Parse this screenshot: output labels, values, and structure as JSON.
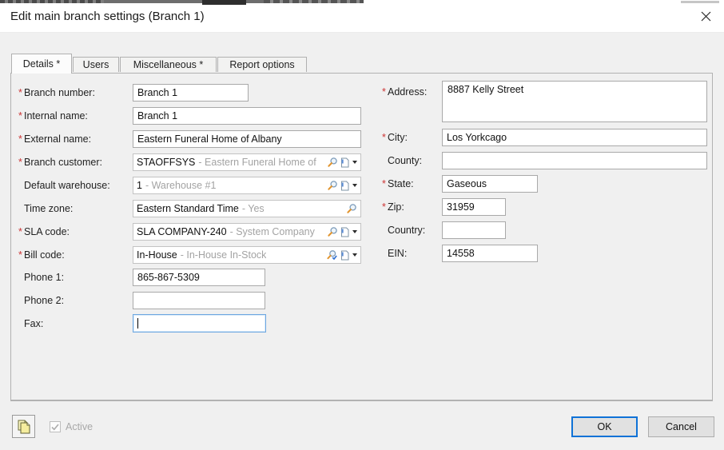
{
  "window": {
    "title": "Edit main branch settings (Branch 1)"
  },
  "icons": {
    "close": "✕",
    "lookup": "magnifier",
    "lookup_verified": "magnifier-with-check",
    "quick_add": "page-with-caret",
    "copy": "stacked-pages",
    "active_check": "✓"
  },
  "marks": {
    "required": "*"
  },
  "tabs": [
    {
      "label": "Details *",
      "active": true
    },
    {
      "label": "Users",
      "active": false
    },
    {
      "label": "Miscellaneous *",
      "active": false
    },
    {
      "label": "Report options",
      "active": false
    }
  ],
  "form": {
    "left": [
      {
        "label": "Branch number:",
        "required": true,
        "value": "Branch 1"
      },
      {
        "label": "Internal name:",
        "required": true,
        "value": "Branch 1"
      },
      {
        "label": "External name:",
        "required": true,
        "value": "Eastern Funeral Home of Albany"
      },
      {
        "label": "Branch customer:",
        "required": true,
        "value": "STAOFFSYS",
        "desc": "- Eastern Funeral Home of"
      },
      {
        "label": "Default warehouse:",
        "required": false,
        "value": "1",
        "desc": "- Warehouse #1"
      },
      {
        "label": "Time zone:",
        "required": false,
        "value": "Eastern Standard Time",
        "desc": "- Yes"
      },
      {
        "label": "SLA code:",
        "required": true,
        "value": "SLA COMPANY-240",
        "desc": "- System Company"
      },
      {
        "label": "Bill code:",
        "required": true,
        "value": "In-House",
        "desc": "- In-House In-Stock"
      },
      {
        "label": "Phone 1:",
        "required": false,
        "value": "865-867-5309"
      },
      {
        "label": "Phone 2:",
        "required": false,
        "value": ""
      },
      {
        "label": "Fax:",
        "required": false,
        "value": ""
      }
    ],
    "right": [
      {
        "label": "Address:",
        "required": true,
        "value": "8887 Kelly Street"
      },
      {
        "label": "City:",
        "required": true,
        "value": "Los Yorkcago"
      },
      {
        "label": "County:",
        "required": false,
        "value": ""
      },
      {
        "label": "State:",
        "required": true,
        "value": "Gaseous"
      },
      {
        "label": "Zip:",
        "required": true,
        "value": "31959"
      },
      {
        "label": "Country:",
        "required": false,
        "value": ""
      },
      {
        "label": "EIN:",
        "required": false,
        "value": "14558"
      }
    ]
  },
  "footer": {
    "active_label": "Active",
    "active_checked": true,
    "ok_label": "OK",
    "cancel_label": "Cancel"
  },
  "colors": {
    "dialog_bg": "#f0f0f0",
    "titlebar_bg": "#ffffff",
    "input_border": "#a9a9a9",
    "focus_border": "#6ea7e0",
    "required_mark": "#cc3333",
    "muted_text": "#a3a3a3",
    "ok_border": "#0f72d7",
    "button_bg": "#e1e1e1"
  }
}
